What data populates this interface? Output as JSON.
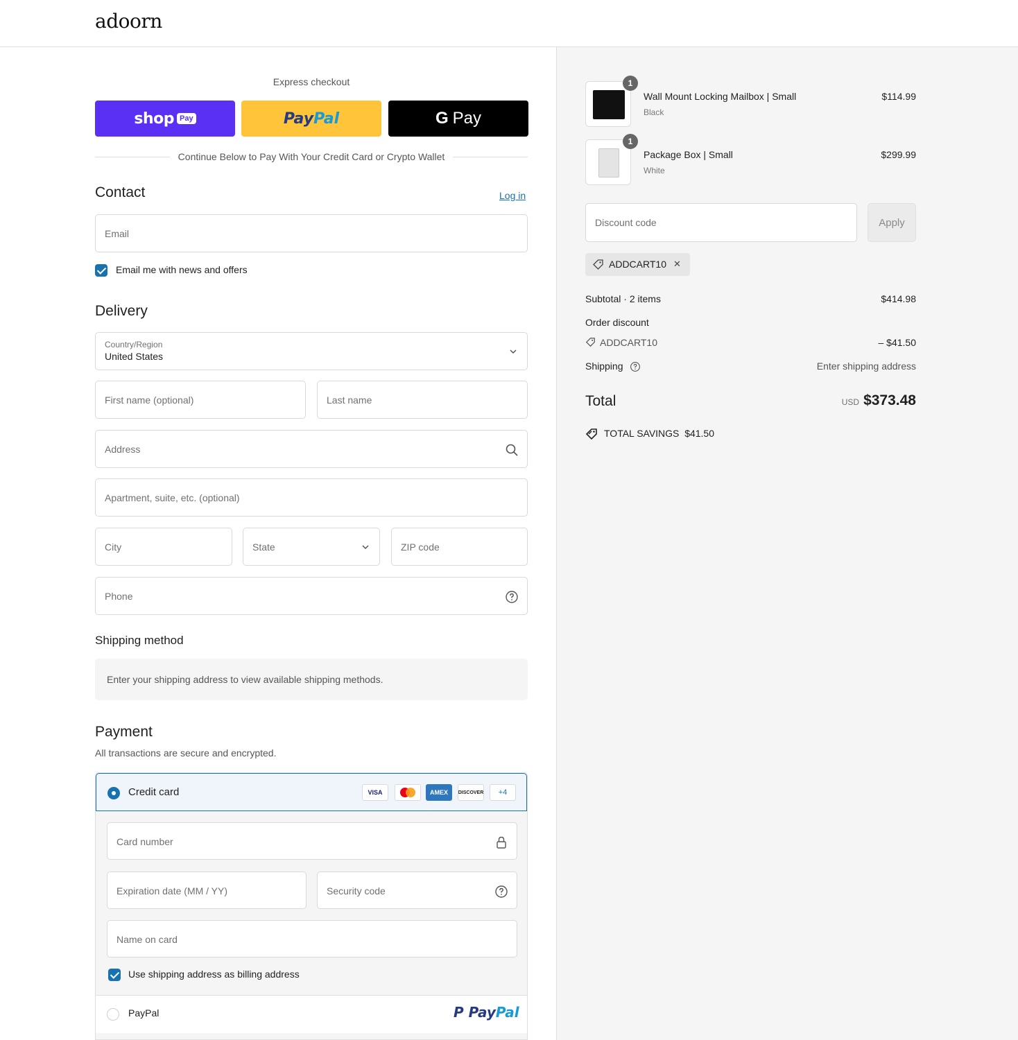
{
  "brand": {
    "logo": "adoorn"
  },
  "express": {
    "title": "Express checkout",
    "shop_label": "shop",
    "shop_tag": "Pay",
    "paypal_part1": "Pay",
    "paypal_part2": "Pal",
    "gpay_g": "G",
    "gpay_label": "Pay",
    "divider": "Continue Below to Pay With Your Credit Card or Crypto Wallet"
  },
  "contact": {
    "title": "Contact",
    "login_link": "Log in",
    "email_placeholder": "Email",
    "newsletter_label": "Email me with news and offers",
    "newsletter_checked": true
  },
  "delivery": {
    "title": "Delivery",
    "country_label": "Country/Region",
    "country_value": "United States",
    "first_name_ph": "First name (optional)",
    "last_name_ph": "Last name",
    "address_ph": "Address",
    "apartment_ph": "Apartment, suite, etc. (optional)",
    "city_ph": "City",
    "state_ph": "State",
    "zip_ph": "ZIP code",
    "phone_ph": "Phone"
  },
  "shipping_method": {
    "title": "Shipping method",
    "info": "Enter your shipping address to view available shipping methods."
  },
  "payment": {
    "title": "Payment",
    "subtitle": "All transactions are secure and encrypted.",
    "credit_card_label": "Credit card",
    "card_logos": [
      "VISA",
      "MC",
      "AMEX",
      "DISCOVER",
      "+4"
    ],
    "card_number_ph": "Card number",
    "expiration_ph": "Expiration date (MM / YY)",
    "security_ph": "Security code",
    "name_ph": "Name on card",
    "billing_same_label": "Use shipping address as billing address",
    "billing_same_checked": true,
    "paypal_option_label": "PayPal",
    "paypal_logo_1": "Pay",
    "paypal_logo_2": "Pal"
  },
  "cart": {
    "items": [
      {
        "name": "Wall Mount Locking Mailbox | Small",
        "variant": "Black",
        "price": "$114.99",
        "qty": "1"
      },
      {
        "name": "Package Box | Small",
        "variant": "White",
        "price": "$299.99",
        "qty": "1"
      }
    ],
    "discount_placeholder": "Discount code",
    "apply_label": "Apply",
    "applied_code": "ADDCART10",
    "remove_symbol": "✕"
  },
  "summary": {
    "subtotal_label": "Subtotal · 2 items",
    "subtotal_value": "$414.98",
    "order_discount_label": "Order discount",
    "discount_code": "ADDCART10",
    "discount_value": "– $41.50",
    "shipping_label": "Shipping",
    "shipping_value": "Enter shipping address",
    "total_label": "Total",
    "currency": "USD",
    "total_value": "$373.48",
    "savings_label": "TOTAL SAVINGS",
    "savings_value": "$41.50"
  },
  "colors": {
    "shop_purple": "#5a31f4",
    "paypal_yellow": "#ffc439",
    "link_blue": "#1773b0"
  }
}
